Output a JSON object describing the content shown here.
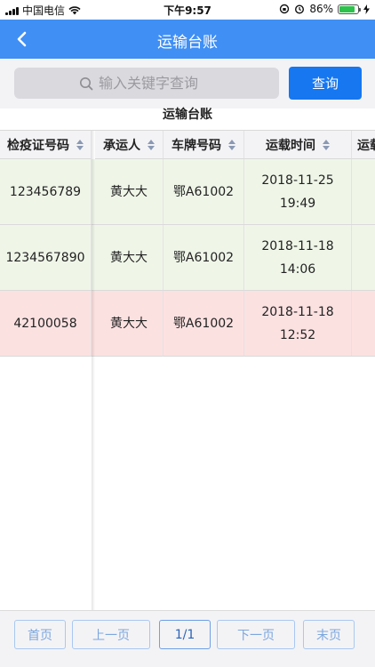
{
  "status_bar": {
    "carrier": "中国电信",
    "time": "下午9:57",
    "battery": "86%",
    "battery_level": 0.86
  },
  "nav": {
    "title": "运输台账",
    "back_icon": "chevron-left-icon"
  },
  "search": {
    "placeholder": "输入关键字查询",
    "value": "",
    "button_label": "查询"
  },
  "table": {
    "title": "运输台账",
    "columns": [
      "检疫证号码",
      "承运人",
      "车牌号码",
      "运载时间",
      "运载"
    ],
    "rows": [
      {
        "cert_no": "123456789",
        "carrier": "黄大大",
        "plate": "鄂A61002",
        "time": "2018-11-25 19:49",
        "status_color": "#eff6e8"
      },
      {
        "cert_no": "1234567890",
        "carrier": "黄大大",
        "plate": "鄂A61002",
        "time": "2018-11-18 14:06",
        "status_color": "#eff6e8"
      },
      {
        "cert_no": "42100058",
        "carrier": "黄大大",
        "plate": "鄂A61002",
        "time": "2018-11-18 12:52",
        "status_color": "#fce1e1"
      }
    ]
  },
  "pager": {
    "first": "首页",
    "prev": "上一页",
    "current": "1/1",
    "next": "下一页",
    "last": "末页"
  },
  "colors": {
    "nav_bg": "#3f8ff5",
    "search_button": "#1677f0",
    "row_green": "#eff6e8",
    "row_red": "#fce1e1"
  }
}
